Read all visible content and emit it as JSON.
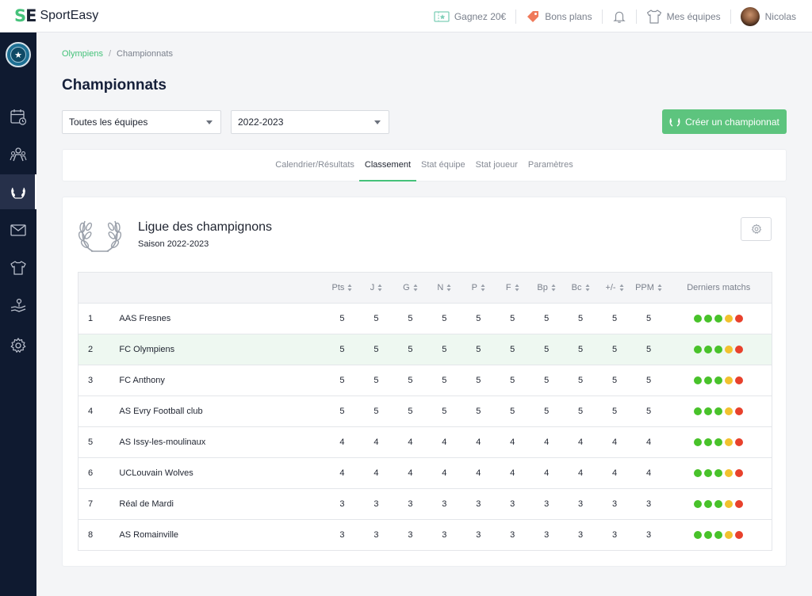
{
  "brand": {
    "logo_s": "S",
    "logo_e": "E",
    "name": "SportEasy"
  },
  "topbar": {
    "referral": "Gagnez 20€",
    "deals": "Bons plans",
    "teams": "Mes équipes",
    "user": "Nicolas"
  },
  "sidebar": {
    "items": [
      {
        "name": "calendar-icon",
        "active": false
      },
      {
        "name": "members-icon",
        "active": false
      },
      {
        "name": "laurel-icon",
        "active": true
      },
      {
        "name": "mail-icon",
        "active": false
      },
      {
        "name": "jersey-icon",
        "active": false
      },
      {
        "name": "handshake-icon",
        "active": false
      },
      {
        "name": "gear-icon",
        "active": false
      }
    ]
  },
  "breadcrumb": {
    "root": "Olympiens",
    "current": "Championnats"
  },
  "page": {
    "title": "Championnats"
  },
  "filters": {
    "team": "Toutes les équipes",
    "season": "2022-2023"
  },
  "create_button": "Créer un championnat",
  "tabs": [
    {
      "label": "Calendrier/Résultats",
      "active": false
    },
    {
      "label": "Classement",
      "active": true
    },
    {
      "label": "Stat équipe",
      "active": false
    },
    {
      "label": "Stat joueur",
      "active": false
    },
    {
      "label": "Paramètres",
      "active": false
    }
  ],
  "league": {
    "name": "Ligue des champignons",
    "season": "Saison 2022-2023"
  },
  "standings": {
    "columns": [
      "Pts",
      "J",
      "G",
      "N",
      "P",
      "F",
      "Bp",
      "Bc",
      "+/-",
      "PPM"
    ],
    "form_header": "Derniers matchs",
    "form_colors": {
      "W": "#48c22a",
      "D": "#f2c12e",
      "L": "#e8412c"
    },
    "rows": [
      {
        "rank": "1",
        "team": "AAS Fresnes",
        "stats": [
          "5",
          "5",
          "5",
          "5",
          "5",
          "5",
          "5",
          "5",
          "5",
          "5"
        ],
        "form": [
          "W",
          "W",
          "W",
          "D",
          "L"
        ],
        "highlight": false
      },
      {
        "rank": "2",
        "team": "FC Olympiens",
        "stats": [
          "5",
          "5",
          "5",
          "5",
          "5",
          "5",
          "5",
          "5",
          "5",
          "5"
        ],
        "form": [
          "W",
          "W",
          "W",
          "D",
          "L"
        ],
        "highlight": true
      },
      {
        "rank": "3",
        "team": "FC Anthony",
        "stats": [
          "5",
          "5",
          "5",
          "5",
          "5",
          "5",
          "5",
          "5",
          "5",
          "5"
        ],
        "form": [
          "W",
          "W",
          "W",
          "D",
          "L"
        ],
        "highlight": false
      },
      {
        "rank": "4",
        "team": "AS Evry Football club",
        "stats": [
          "5",
          "5",
          "5",
          "5",
          "5",
          "5",
          "5",
          "5",
          "5",
          "5"
        ],
        "form": [
          "W",
          "W",
          "W",
          "D",
          "L"
        ],
        "highlight": false
      },
      {
        "rank": "5",
        "team": "AS Issy-les-moulinaux",
        "stats": [
          "4",
          "4",
          "4",
          "4",
          "4",
          "4",
          "4",
          "4",
          "4",
          "4"
        ],
        "form": [
          "W",
          "W",
          "W",
          "D",
          "L"
        ],
        "highlight": false
      },
      {
        "rank": "6",
        "team": "UCLouvain Wolves",
        "stats": [
          "4",
          "4",
          "4",
          "4",
          "4",
          "4",
          "4",
          "4",
          "4",
          "4"
        ],
        "form": [
          "W",
          "W",
          "W",
          "D",
          "L"
        ],
        "highlight": false
      },
      {
        "rank": "7",
        "team": "Réal de Mardi",
        "stats": [
          "3",
          "3",
          "3",
          "3",
          "3",
          "3",
          "3",
          "3",
          "3",
          "3"
        ],
        "form": [
          "W",
          "W",
          "W",
          "D",
          "L"
        ],
        "highlight": false
      },
      {
        "rank": "8",
        "team": "AS Romainville",
        "stats": [
          "3",
          "3",
          "3",
          "3",
          "3",
          "3",
          "3",
          "3",
          "3",
          "3"
        ],
        "form": [
          "W",
          "W",
          "W",
          "D",
          "L"
        ],
        "highlight": false
      }
    ]
  }
}
